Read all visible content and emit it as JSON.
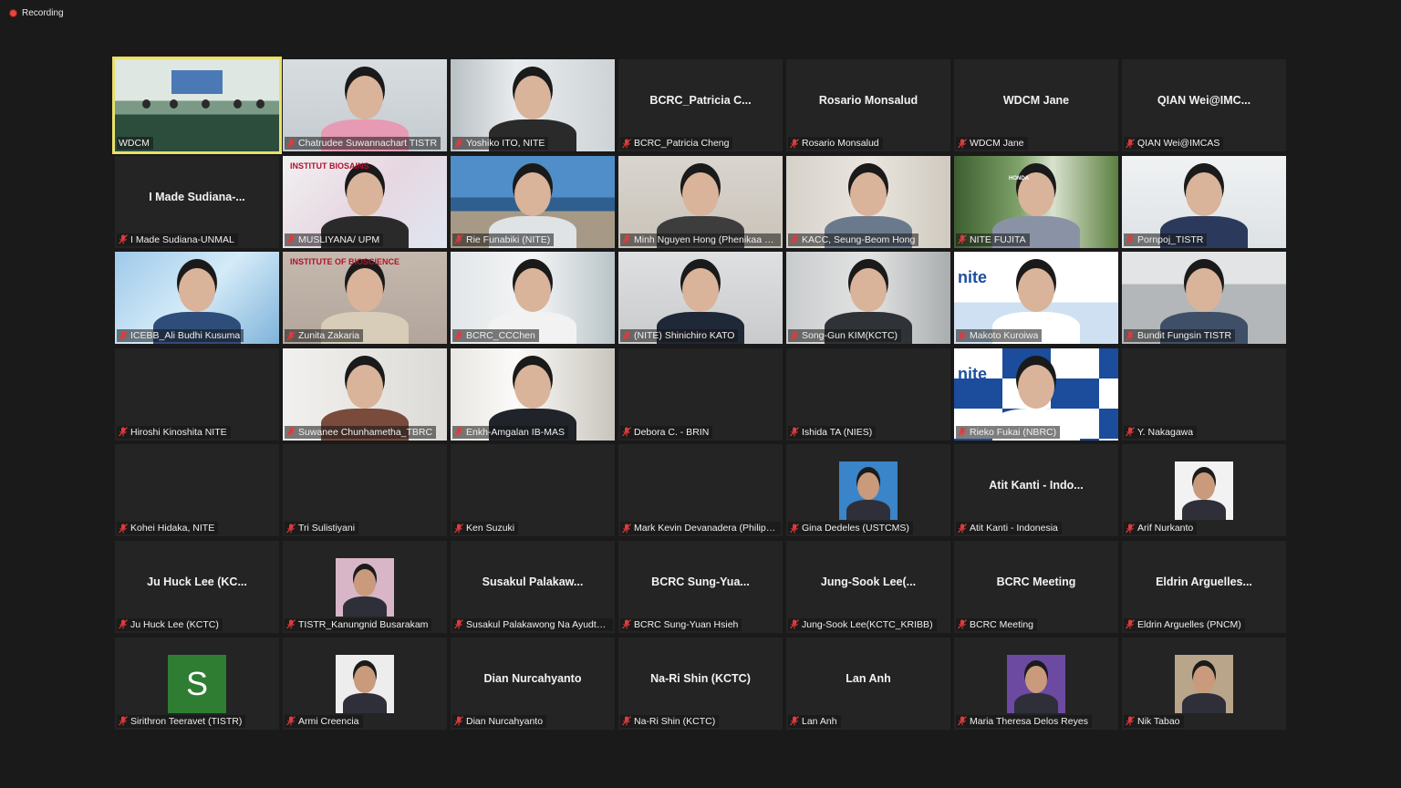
{
  "recording": {
    "label": "Recording"
  },
  "colors": {
    "active_border": "#e8e06a",
    "muted_mic": "#e03b3b",
    "tile_bg": "#242424"
  },
  "participants": [
    {
      "label": "WDCM",
      "type": "video",
      "variant": "room",
      "active": true
    },
    {
      "label": "Chatrudee Suwannachart TISTR",
      "type": "video",
      "variant": "pinkmask"
    },
    {
      "label": "Yoshiko ITO, NITE",
      "type": "video",
      "variant": "office"
    },
    {
      "label": "BCRC_Patricia Cheng",
      "type": "name",
      "display": "BCRC_Patricia  C..."
    },
    {
      "label": "Rosario Monsalud",
      "type": "name",
      "display": "Rosario Monsalud"
    },
    {
      "label": "WDCM Jane",
      "type": "name",
      "display": "WDCM Jane"
    },
    {
      "label": "QIAN Wei@IMCAS",
      "type": "name",
      "display": "QIAN  Wei@IMC..."
    },
    {
      "label": "I Made Sudiana-UNMAL",
      "type": "name",
      "display": "I  Made  Sudiana-..."
    },
    {
      "label": "MUSLIYANA/ UPM",
      "type": "video",
      "variant": "biosains",
      "banner": "INSTITUT BIOSAINS"
    },
    {
      "label": "Rie Funabiki (NITE)",
      "type": "video",
      "variant": "sea"
    },
    {
      "label": "Minh Nguyen Hong (Phenikaa U...",
      "type": "video",
      "variant": "glasses"
    },
    {
      "label": "KACC, Seung-Beom Hong",
      "type": "video",
      "variant": "headset"
    },
    {
      "label": "NITE FUJITA",
      "type": "video",
      "variant": "forest",
      "banner": "HONDA"
    },
    {
      "label": "Pornpoj_TISTR",
      "type": "video",
      "variant": "lightroom"
    },
    {
      "label": "ICEBB_Ali Budhi Kusuma",
      "type": "video",
      "variant": "bluebg"
    },
    {
      "label": "Zunita Zakaria",
      "type": "video",
      "variant": "bioscience",
      "banner": "INSTITUTE OF BIOSCIENCE"
    },
    {
      "label": "BCRC_CCChen",
      "type": "video",
      "variant": "officewhite"
    },
    {
      "label": "(NITE) Shinichiro KATO",
      "type": "video",
      "variant": "suit"
    },
    {
      "label": "Song-Gun KIM(KCTC)",
      "type": "video",
      "variant": "officegrey"
    },
    {
      "label": "Makoto Kuroiwa",
      "type": "video",
      "variant": "nitecity",
      "banner": "nite"
    },
    {
      "label": "Bundit Fungsin TISTR",
      "type": "video",
      "variant": "windowoffice"
    },
    {
      "label": "Hiroshi Kinoshita NITE",
      "type": "name",
      "display": ""
    },
    {
      "label": "Suwanee Chunhametha_TBRC",
      "type": "video",
      "variant": "whitewall"
    },
    {
      "label": "Enkh-Amgalan IB-MAS",
      "type": "video",
      "variant": "livingroom"
    },
    {
      "label": "Debora C. - BRIN",
      "type": "name",
      "display": ""
    },
    {
      "label": "Ishida TA (NIES)",
      "type": "name",
      "display": ""
    },
    {
      "label": "Rieko Fukai (NBRC)",
      "type": "video",
      "variant": "nitegrid",
      "banner": "nite"
    },
    {
      "label": "Y. Nakagawa",
      "type": "name",
      "display": ""
    },
    {
      "label": "Kohei Hidaka, NITE",
      "type": "name",
      "display": ""
    },
    {
      "label": "Tri Sulistiyani",
      "type": "name",
      "display": ""
    },
    {
      "label": "Ken Suzuki",
      "type": "name",
      "display": ""
    },
    {
      "label": "Mark Kevin Devanadera (Philippi...",
      "type": "name",
      "display": ""
    },
    {
      "label": "Gina Dedeles (USTCMS)",
      "type": "photo",
      "variant": "portraitblue"
    },
    {
      "label": "Atit Kanti - Indonesia",
      "type": "name",
      "display": "Atit  Kanti  -  Indo..."
    },
    {
      "label": "Arif Nurkanto",
      "type": "photo",
      "variant": "portraitwhite"
    },
    {
      "label": "Ju Huck Lee (KCTC)",
      "type": "name",
      "display": "Ju  Huck  Lee  (KC..."
    },
    {
      "label": "TISTR_Kanungnid Busarakam",
      "type": "photo",
      "variant": "portraitflowers"
    },
    {
      "label": "Susakul Palakawong Na Ayudtha...",
      "type": "name",
      "display": "Susakul   Palakaw..."
    },
    {
      "label": "BCRC Sung-Yuan Hsieh",
      "type": "name",
      "display": "BCRC   Sung-Yua..."
    },
    {
      "label": "Jung-Sook Lee(KCTC_KRIBB)",
      "type": "name",
      "display": "Jung-Sook   Lee(..."
    },
    {
      "label": "BCRC Meeting",
      "type": "name",
      "display": "BCRC  Meeting"
    },
    {
      "label": "Eldrin Arguelles (PNCM)",
      "type": "name",
      "display": "Eldrin   Arguelles..."
    },
    {
      "label": "Sirithron Teeravet (TISTR)",
      "type": "letter",
      "letter": "S"
    },
    {
      "label": "Armi Creencia",
      "type": "photo",
      "variant": "portraitwhite2"
    },
    {
      "label": "Dian Nurcahyanto",
      "type": "name",
      "display": "Dian  Nurcahyanto"
    },
    {
      "label": "Na-Ri Shin (KCTC)",
      "type": "name",
      "display": "Na-Ri  Shin  (KCTC)"
    },
    {
      "label": "Lan Anh",
      "type": "name",
      "display": "Lan  Anh"
    },
    {
      "label": "Maria Theresa Delos Reyes",
      "type": "photo",
      "variant": "portraitpurple"
    },
    {
      "label": "Nik Tabao",
      "type": "photo",
      "variant": "portraitoffice"
    }
  ]
}
